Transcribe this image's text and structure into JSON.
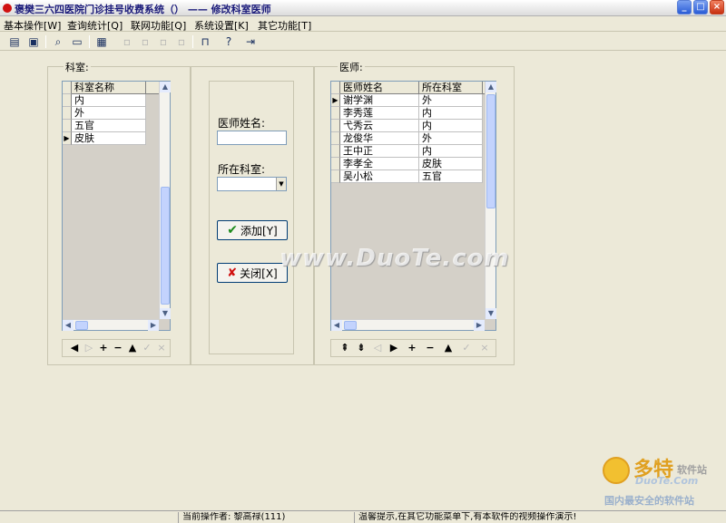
{
  "window": {
    "title": "褒樊三六四医院门诊挂号收费系统（） —— 修改科室医师",
    "minimize_icon": "minimize-icon",
    "maximize_icon": "maximize-icon",
    "close_icon": "close-icon"
  },
  "menu": [
    {
      "label": "基本操作[W]"
    },
    {
      "label": "查询统计[Q]"
    },
    {
      "label": "联网功能[Q]"
    },
    {
      "label": "系统设置[K]"
    },
    {
      "label": "其它功能[T]"
    }
  ],
  "toolbar": {
    "icons": [
      "window-icon",
      "window-list-icon",
      "preview-icon",
      "message-icon",
      "calculator-icon",
      "lock-icon",
      "help-icon",
      "exit-icon"
    ]
  },
  "departments": {
    "group_label": "科室:",
    "column_header": "科室名称",
    "rows": [
      "内",
      "外",
      "五官",
      "皮肤"
    ],
    "current_row": 3
  },
  "form": {
    "doctor_name_label": "医师姓名:",
    "doctor_name_value": "",
    "department_label": "所在科室:",
    "department_value": "",
    "add_button": "添加[Y]",
    "close_button": "关闭[X]"
  },
  "doctors": {
    "group_label": "医师:",
    "columns": [
      "医师姓名",
      "所在科室"
    ],
    "rows": [
      [
        "谢学渊",
        "外"
      ],
      [
        "李秀莲",
        "内"
      ],
      [
        "弋秀云",
        "内"
      ],
      [
        "龙俊华",
        "外"
      ],
      [
        "王中正",
        "内"
      ],
      [
        "李孝全",
        "皮肤"
      ],
      [
        "吴小松",
        "五官"
      ]
    ],
    "current_row": 0
  },
  "watermark": "www.DuoTe.com",
  "logo": {
    "name": "多特",
    "sub": "软件站",
    "en": "DuoTe.Com",
    "slogan": "国内最安全的软件站"
  },
  "status": {
    "operator": "当前操作者: 黎高禄(111)",
    "tip": "温馨提示,在其它功能菜单下,有本软件的视频操作演示!"
  }
}
